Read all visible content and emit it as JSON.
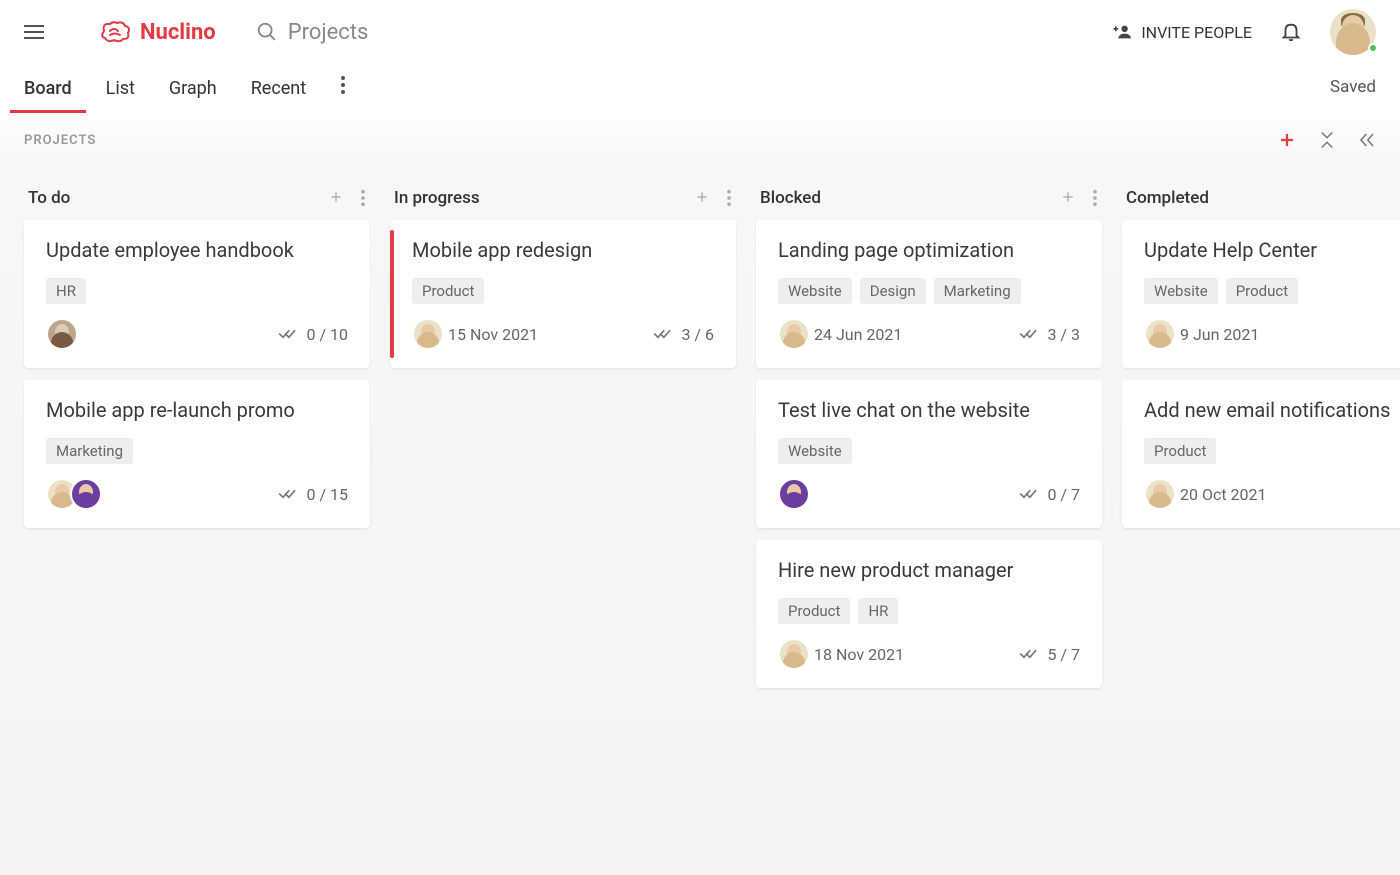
{
  "app": {
    "logo_text": "Nuclino",
    "search_placeholder": "Projects",
    "invite_label": "INVITE PEOPLE",
    "status_text": "Saved"
  },
  "tabs": {
    "items": [
      "Board",
      "List",
      "Graph",
      "Recent"
    ],
    "active_index": 0
  },
  "board": {
    "title": "PROJECTS",
    "columns": [
      {
        "title": "To do",
        "show_actions": true,
        "cards": [
          {
            "title": "Update employee handbook",
            "tags": [
              "HR"
            ],
            "avatars": [
              "photo"
            ],
            "date": "",
            "progress": "0 / 10",
            "highlight": false
          },
          {
            "title": "Mobile app re-launch promo",
            "tags": [
              "Marketing"
            ],
            "avatars": [
              "beige",
              "purple"
            ],
            "date": "",
            "progress": "0 / 15",
            "highlight": false
          }
        ]
      },
      {
        "title": "In progress",
        "show_actions": true,
        "cards": [
          {
            "title": "Mobile app redesign",
            "tags": [
              "Product"
            ],
            "avatars": [
              "beige"
            ],
            "date": "15 Nov 2021",
            "progress": "3 / 6",
            "highlight": true
          }
        ]
      },
      {
        "title": "Blocked",
        "show_actions": true,
        "cards": [
          {
            "title": "Landing page optimization",
            "tags": [
              "Website",
              "Design",
              "Marketing"
            ],
            "avatars": [
              "beige"
            ],
            "date": "24 Jun 2021",
            "progress": "3 / 3",
            "highlight": false
          },
          {
            "title": "Test live chat on the website",
            "tags": [
              "Website"
            ],
            "avatars": [
              "purple"
            ],
            "date": "",
            "progress": "0 / 7",
            "highlight": false
          },
          {
            "title": "Hire new product manager",
            "tags": [
              "Product",
              "HR"
            ],
            "avatars": [
              "beige"
            ],
            "date": "18 Nov 2021",
            "progress": "5 / 7",
            "highlight": false
          }
        ]
      },
      {
        "title": "Completed",
        "show_actions": false,
        "cards": [
          {
            "title": "Update Help Center",
            "tags": [
              "Website",
              "Product"
            ],
            "avatars": [
              "beige"
            ],
            "date": "9 Jun 2021",
            "progress": "",
            "highlight": false
          },
          {
            "title": "Add new email notifications",
            "tags": [
              "Product"
            ],
            "avatars": [
              "beige"
            ],
            "date": "20 Oct 2021",
            "progress": "",
            "highlight": false
          }
        ]
      }
    ]
  }
}
